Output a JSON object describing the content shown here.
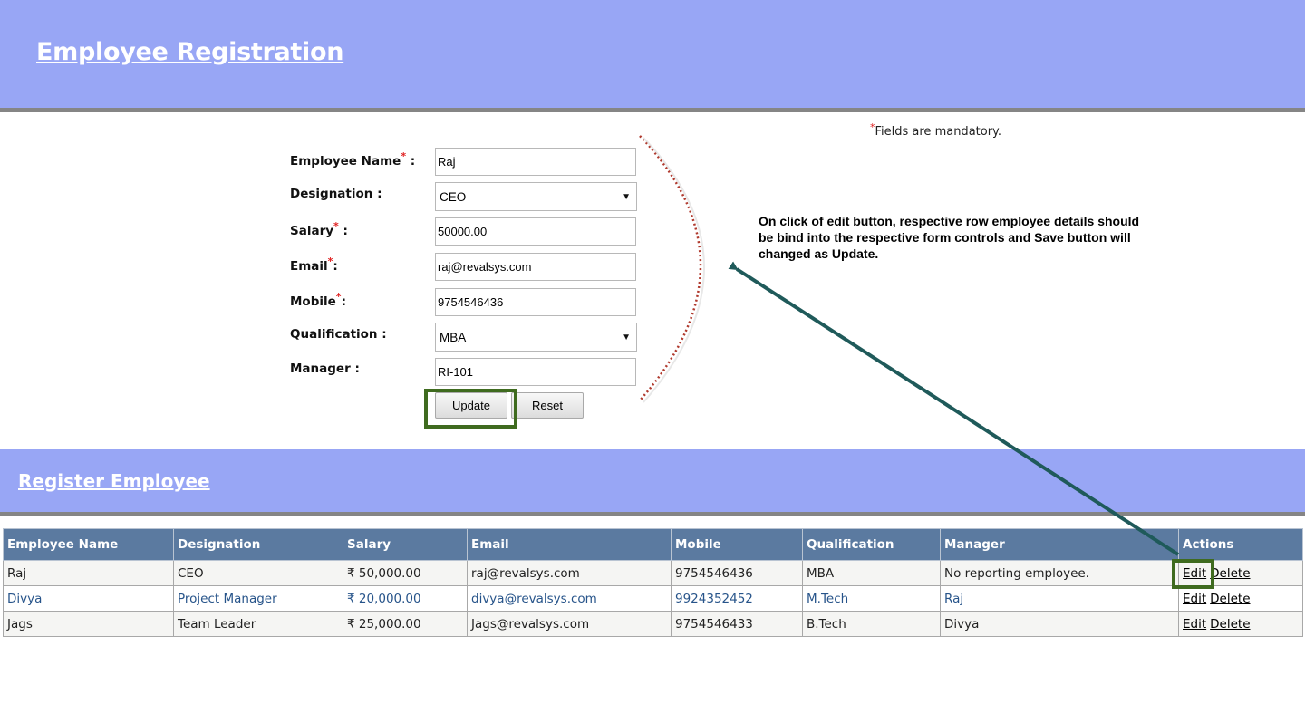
{
  "header": {
    "title": "Employee Registration"
  },
  "form": {
    "mandatory_note": "Fields are mandatory.",
    "required_mark": "*",
    "fields": {
      "name": {
        "label": "Employee Name",
        "suffix": ":",
        "value": "Raj"
      },
      "designation": {
        "label": "Designation :",
        "value": "CEO"
      },
      "salary": {
        "label": "Salary",
        "suffix": ":",
        "value": "50000.00"
      },
      "email": {
        "label": "Email",
        "suffix": ":",
        "value": "raj@revalsys.com"
      },
      "mobile": {
        "label": "Mobile",
        "suffix": ":",
        "value": "9754546436"
      },
      "qualification": {
        "label": "Qualification :",
        "value": "MBA"
      },
      "manager": {
        "label": "Manager :",
        "value": "RI-101"
      }
    },
    "update_label": "Update",
    "reset_label": "Reset"
  },
  "annotation": {
    "text": "On click of edit button, respective row employee details should be bind into the respective form controls and Save button will changed as Update."
  },
  "section": {
    "title": "Register Employee"
  },
  "table": {
    "headers": [
      "Employee Name",
      "Designation",
      "Salary",
      "Email",
      "Mobile",
      "Qualification",
      "Manager",
      "Actions"
    ],
    "rows": [
      {
        "name": "Raj",
        "designation": "CEO",
        "salary": "₹ 50,000.00",
        "email": "raj@revalsys.com",
        "mobile": "9754546436",
        "qualification": "MBA",
        "manager": "No reporting employee.",
        "edit": "Edit",
        "delete": "Delete"
      },
      {
        "name": "Divya",
        "designation": "Project Manager",
        "salary": "₹ 20,000.00",
        "email": "divya@revalsys.com",
        "mobile": "9924352452",
        "qualification": "M.Tech",
        "manager": "Raj",
        "edit": "Edit",
        "delete": "Delete"
      },
      {
        "name": "Jags",
        "designation": "Team Leader",
        "salary": "₹ 25,000.00",
        "email": "Jags@revalsys.com",
        "mobile": "9754546433",
        "qualification": "B.Tech",
        "manager": "Divya",
        "edit": "Edit",
        "delete": "Delete"
      }
    ]
  },
  "colors": {
    "header_bg": "#98a6f5",
    "table_header_bg": "#5b7aa0",
    "highlight_border": "#3f6b1f",
    "arrow": "#1f5a5a",
    "bracket": "#b03a2e"
  }
}
